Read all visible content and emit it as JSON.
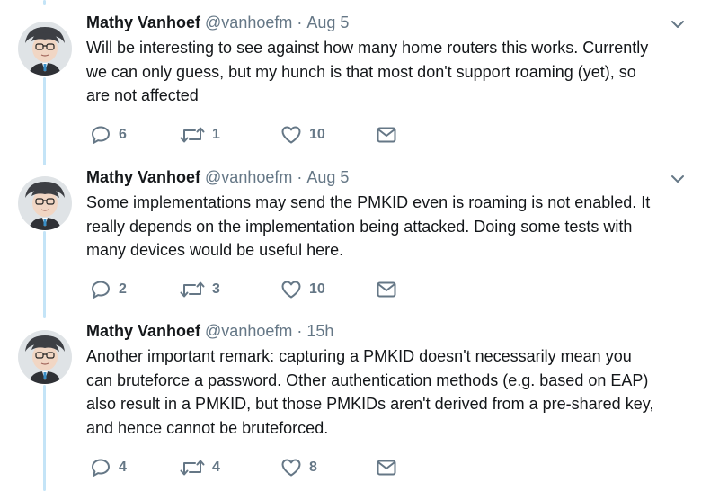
{
  "tweets": [
    {
      "name": "Mathy Vanhoef",
      "handle": "@vanhoefm",
      "separator": "·",
      "time": "Aug 5",
      "text": "Will be interesting to see against how many home routers this works. Currently\nwe can only guess, but my hunch is that most don't support roaming (yet), so\nare not affected",
      "replies": "6",
      "retweets": "1",
      "likes": "10"
    },
    {
      "name": "Mathy Vanhoef",
      "handle": "@vanhoefm",
      "separator": "·",
      "time": "Aug 5",
      "text": "Some implementations may send the PMKID even is roaming is not enabled.   It\nreally depends on the implementation being attacked. Doing some  tests with\nmany devices would be useful here.",
      "replies": "2",
      "retweets": "3",
      "likes": "10"
    },
    {
      "name": "Mathy Vanhoef",
      "handle": "@vanhoefm",
      "separator": "·",
      "time": "15h",
      "text": "Another important remark: capturing a PMKID doesn't necessarily mean you\ncan bruteforce a password. Other authentication methods (e.g. based on  EAP)\nalso result in a PMKID, but those PMKIDs aren't derived from a  pre-shared key,\nand hence cannot be bruteforced.",
      "replies": "4",
      "retweets": "4",
      "likes": "8"
    }
  ],
  "icons": {
    "reply": "reply-icon",
    "retweet": "retweet-icon",
    "like": "heart-icon",
    "message": "envelope-icon",
    "more": "chevron-down-icon"
  },
  "colors": {
    "thread_line": "#c4e4f7",
    "icon": "#657786",
    "text": "#14171a"
  }
}
